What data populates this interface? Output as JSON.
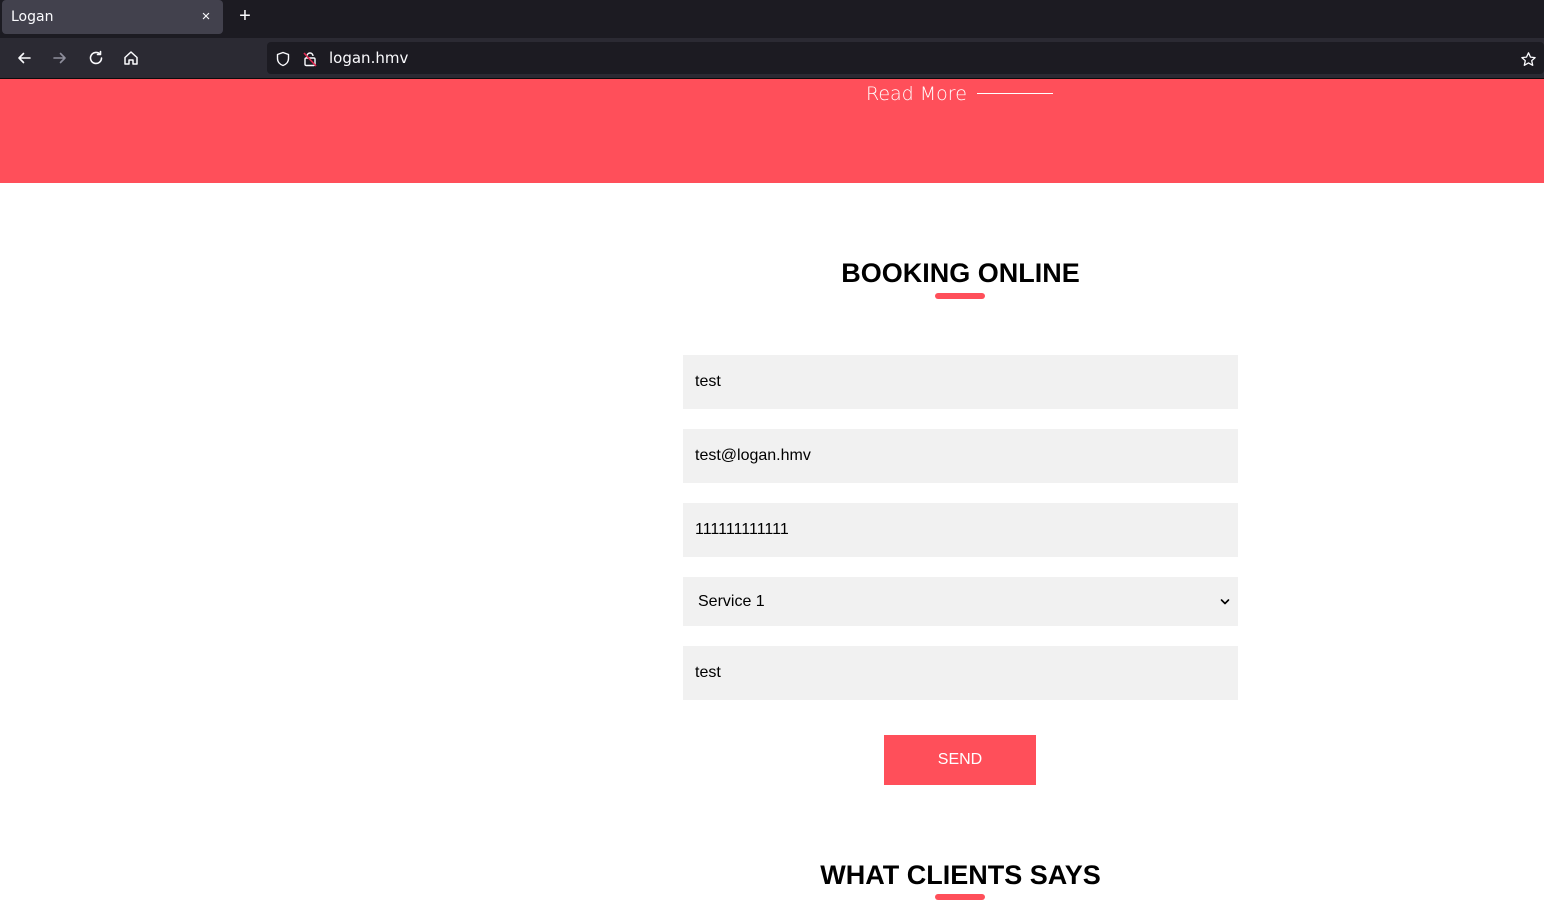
{
  "browser": {
    "tab_title": "Logan",
    "tab_close": "×",
    "new_tab": "+",
    "url": "logan.hmv"
  },
  "hero": {
    "read_more": "Read More"
  },
  "booking": {
    "title": "BOOKING ONLINE",
    "name_value": "test",
    "email_value": "test@logan.hmv",
    "phone_value": "111111111111",
    "service_value": "Service 1",
    "message_value": "test",
    "send_label": "SEND"
  },
  "clients": {
    "title": "WHAT CLIENTS SAYS"
  },
  "colors": {
    "accent": "#ff4f5a",
    "field_bg": "#f1f1f1"
  }
}
